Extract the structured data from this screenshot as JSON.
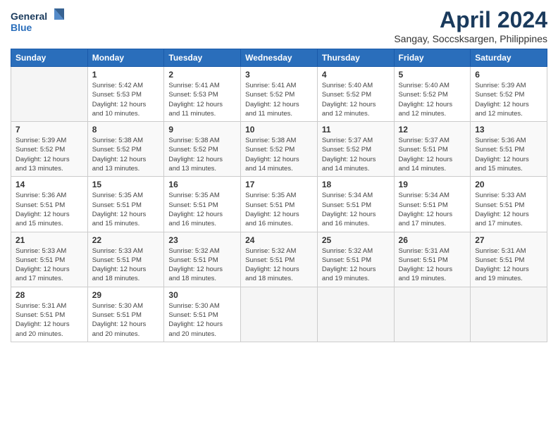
{
  "logo": {
    "line1": "General",
    "line2": "Blue"
  },
  "title": "April 2024",
  "location": "Sangay, Soccsksargen, Philippines",
  "days_of_week": [
    "Sunday",
    "Monday",
    "Tuesday",
    "Wednesday",
    "Thursday",
    "Friday",
    "Saturday"
  ],
  "weeks": [
    [
      {
        "day": "",
        "info": ""
      },
      {
        "day": "1",
        "info": "Sunrise: 5:42 AM\nSunset: 5:53 PM\nDaylight: 12 hours\nand 10 minutes."
      },
      {
        "day": "2",
        "info": "Sunrise: 5:41 AM\nSunset: 5:53 PM\nDaylight: 12 hours\nand 11 minutes."
      },
      {
        "day": "3",
        "info": "Sunrise: 5:41 AM\nSunset: 5:52 PM\nDaylight: 12 hours\nand 11 minutes."
      },
      {
        "day": "4",
        "info": "Sunrise: 5:40 AM\nSunset: 5:52 PM\nDaylight: 12 hours\nand 12 minutes."
      },
      {
        "day": "5",
        "info": "Sunrise: 5:40 AM\nSunset: 5:52 PM\nDaylight: 12 hours\nand 12 minutes."
      },
      {
        "day": "6",
        "info": "Sunrise: 5:39 AM\nSunset: 5:52 PM\nDaylight: 12 hours\nand 12 minutes."
      }
    ],
    [
      {
        "day": "7",
        "info": "Sunrise: 5:39 AM\nSunset: 5:52 PM\nDaylight: 12 hours\nand 13 minutes."
      },
      {
        "day": "8",
        "info": "Sunrise: 5:38 AM\nSunset: 5:52 PM\nDaylight: 12 hours\nand 13 minutes."
      },
      {
        "day": "9",
        "info": "Sunrise: 5:38 AM\nSunset: 5:52 PM\nDaylight: 12 hours\nand 13 minutes."
      },
      {
        "day": "10",
        "info": "Sunrise: 5:38 AM\nSunset: 5:52 PM\nDaylight: 12 hours\nand 14 minutes."
      },
      {
        "day": "11",
        "info": "Sunrise: 5:37 AM\nSunset: 5:52 PM\nDaylight: 12 hours\nand 14 minutes."
      },
      {
        "day": "12",
        "info": "Sunrise: 5:37 AM\nSunset: 5:51 PM\nDaylight: 12 hours\nand 14 minutes."
      },
      {
        "day": "13",
        "info": "Sunrise: 5:36 AM\nSunset: 5:51 PM\nDaylight: 12 hours\nand 15 minutes."
      }
    ],
    [
      {
        "day": "14",
        "info": "Sunrise: 5:36 AM\nSunset: 5:51 PM\nDaylight: 12 hours\nand 15 minutes."
      },
      {
        "day": "15",
        "info": "Sunrise: 5:35 AM\nSunset: 5:51 PM\nDaylight: 12 hours\nand 15 minutes."
      },
      {
        "day": "16",
        "info": "Sunrise: 5:35 AM\nSunset: 5:51 PM\nDaylight: 12 hours\nand 16 minutes."
      },
      {
        "day": "17",
        "info": "Sunrise: 5:35 AM\nSunset: 5:51 PM\nDaylight: 12 hours\nand 16 minutes."
      },
      {
        "day": "18",
        "info": "Sunrise: 5:34 AM\nSunset: 5:51 PM\nDaylight: 12 hours\nand 16 minutes."
      },
      {
        "day": "19",
        "info": "Sunrise: 5:34 AM\nSunset: 5:51 PM\nDaylight: 12 hours\nand 17 minutes."
      },
      {
        "day": "20",
        "info": "Sunrise: 5:33 AM\nSunset: 5:51 PM\nDaylight: 12 hours\nand 17 minutes."
      }
    ],
    [
      {
        "day": "21",
        "info": "Sunrise: 5:33 AM\nSunset: 5:51 PM\nDaylight: 12 hours\nand 17 minutes."
      },
      {
        "day": "22",
        "info": "Sunrise: 5:33 AM\nSunset: 5:51 PM\nDaylight: 12 hours\nand 18 minutes."
      },
      {
        "day": "23",
        "info": "Sunrise: 5:32 AM\nSunset: 5:51 PM\nDaylight: 12 hours\nand 18 minutes."
      },
      {
        "day": "24",
        "info": "Sunrise: 5:32 AM\nSunset: 5:51 PM\nDaylight: 12 hours\nand 18 minutes."
      },
      {
        "day": "25",
        "info": "Sunrise: 5:32 AM\nSunset: 5:51 PM\nDaylight: 12 hours\nand 19 minutes."
      },
      {
        "day": "26",
        "info": "Sunrise: 5:31 AM\nSunset: 5:51 PM\nDaylight: 12 hours\nand 19 minutes."
      },
      {
        "day": "27",
        "info": "Sunrise: 5:31 AM\nSunset: 5:51 PM\nDaylight: 12 hours\nand 19 minutes."
      }
    ],
    [
      {
        "day": "28",
        "info": "Sunrise: 5:31 AM\nSunset: 5:51 PM\nDaylight: 12 hours\nand 20 minutes."
      },
      {
        "day": "29",
        "info": "Sunrise: 5:30 AM\nSunset: 5:51 PM\nDaylight: 12 hours\nand 20 minutes."
      },
      {
        "day": "30",
        "info": "Sunrise: 5:30 AM\nSunset: 5:51 PM\nDaylight: 12 hours\nand 20 minutes."
      },
      {
        "day": "",
        "info": ""
      },
      {
        "day": "",
        "info": ""
      },
      {
        "day": "",
        "info": ""
      },
      {
        "day": "",
        "info": ""
      }
    ]
  ]
}
